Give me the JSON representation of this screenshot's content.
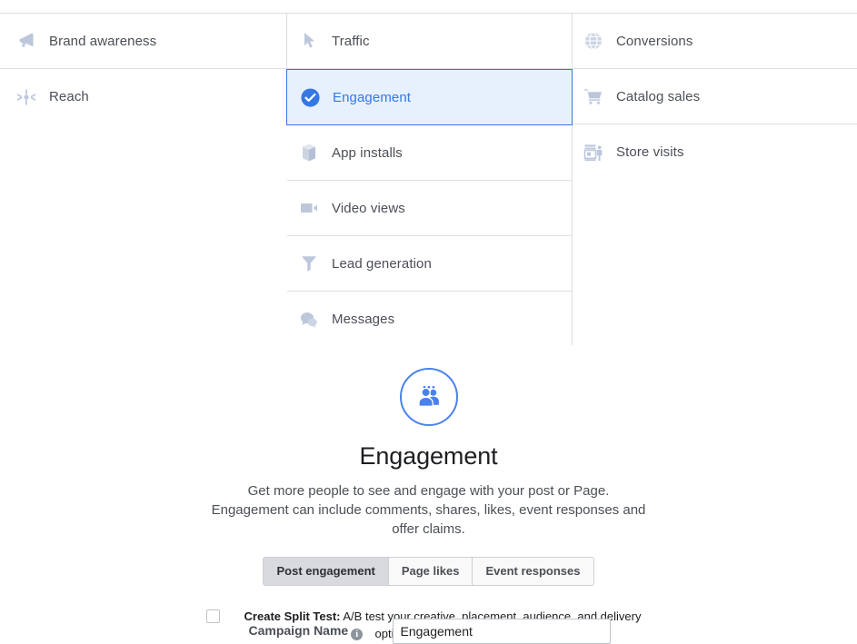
{
  "objectives": {
    "columns": [
      {
        "name": "awareness",
        "items": [
          {
            "label": "Brand awareness",
            "icon": "megaphone-icon",
            "selected": false
          },
          {
            "label": "Reach",
            "icon": "reach-asterisk-icon",
            "selected": false
          }
        ]
      },
      {
        "name": "consideration",
        "items": [
          {
            "label": "Traffic",
            "icon": "cursor-arrow-icon",
            "selected": false
          },
          {
            "label": "Engagement",
            "icon": "check-circle-icon",
            "selected": true
          },
          {
            "label": "App installs",
            "icon": "cube-box-icon",
            "selected": false
          },
          {
            "label": "Video views",
            "icon": "video-camera-icon",
            "selected": false
          },
          {
            "label": "Lead generation",
            "icon": "funnel-icon",
            "selected": false
          },
          {
            "label": "Messages",
            "icon": "speech-bubbles-icon",
            "selected": false
          }
        ]
      },
      {
        "name": "conversion",
        "items": [
          {
            "label": "Conversions",
            "icon": "globe-icon",
            "selected": false
          },
          {
            "label": "Catalog sales",
            "icon": "shopping-cart-icon",
            "selected": false
          },
          {
            "label": "Store visits",
            "icon": "storefront-icon",
            "selected": false
          }
        ]
      }
    ]
  },
  "detail": {
    "icon": "engagement-people-icon",
    "title": "Engagement",
    "description": "Get more people to see and engage with your post or Page. Engagement can include comments, shares, likes, event responses and offer claims.",
    "tabs": [
      {
        "label": "Post engagement",
        "active": true
      },
      {
        "label": "Page likes",
        "active": false
      },
      {
        "label": "Event responses",
        "active": false
      }
    ]
  },
  "split_test": {
    "checked": false,
    "label": "Create Split Test:",
    "description": "A/B test your creative, placement, audience, and delivery optimization strategies",
    "info_glyph": "i"
  },
  "campaign": {
    "label": "Campaign Name",
    "info_glyph": "i",
    "value": "Engagement",
    "placeholder": "Campaign Name"
  },
  "colors": {
    "accent": "#3578e5",
    "selected_bg": "#e7f0fd",
    "icon_gray": "#bdc7db",
    "border": "#dcdee3",
    "text": "#4b4f56"
  }
}
